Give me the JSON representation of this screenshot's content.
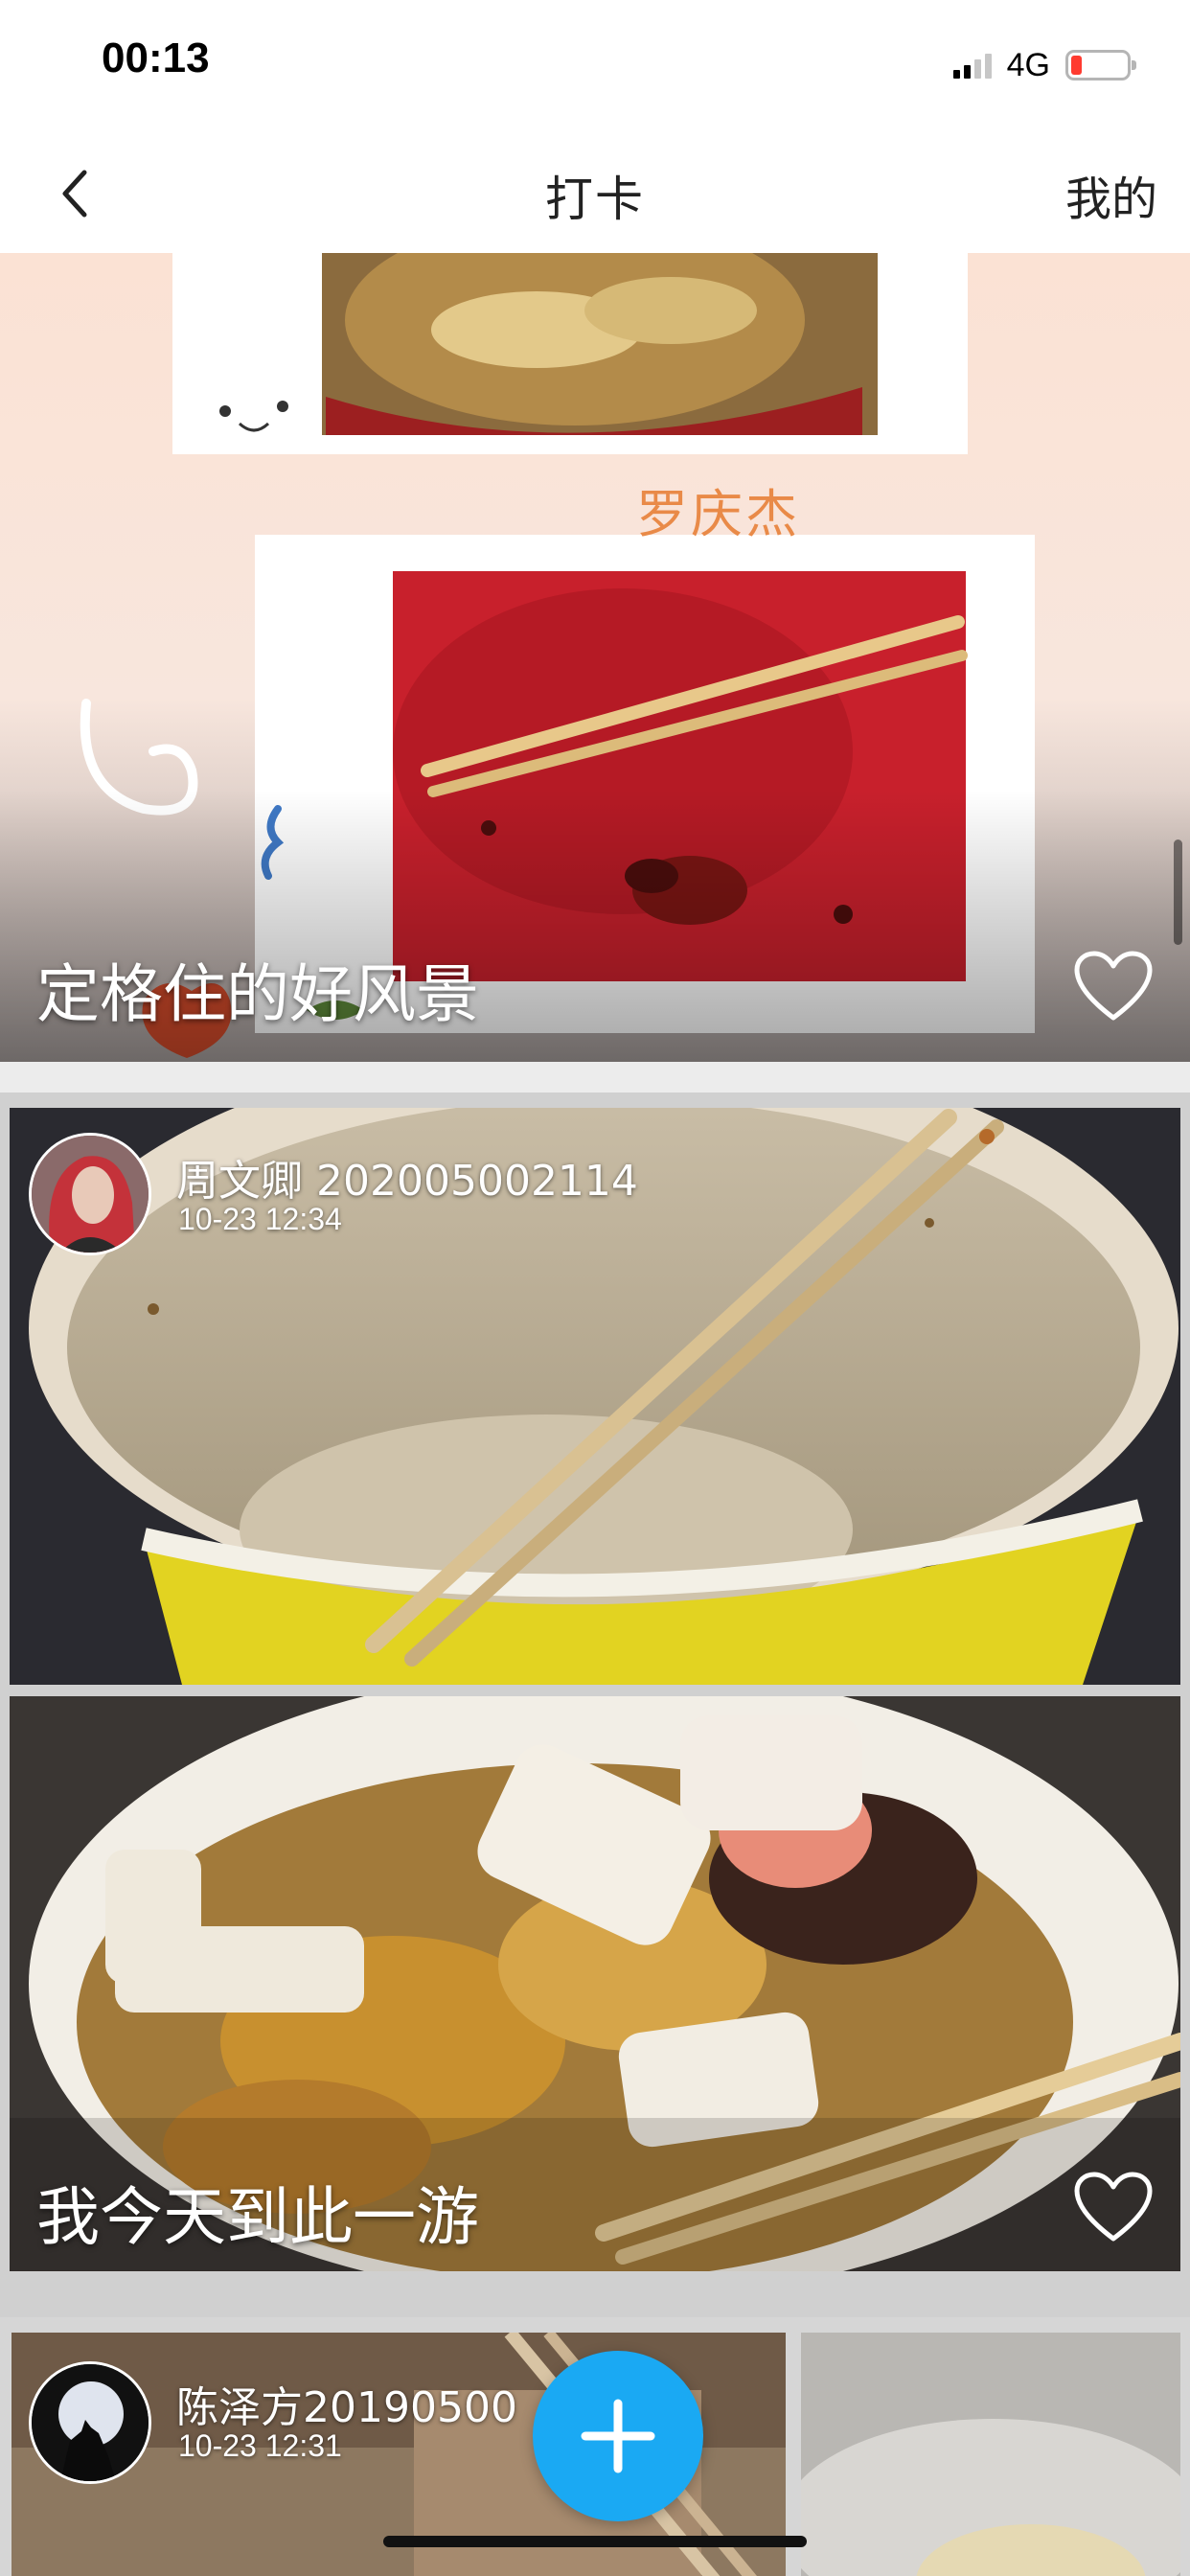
{
  "status_bar": {
    "time": "00:13",
    "network": "4G",
    "battery_color": "#ff3b30"
  },
  "nav": {
    "title": "打卡",
    "right_label": "我的",
    "back_icon": "chevron-left-icon"
  },
  "posts": [
    {
      "caption": "定格住的好风景",
      "photo_text": "罗庆杰",
      "liked": false
    },
    {
      "user_name": "周文卿 202005002114",
      "time": "10-23 12:34",
      "caption": "我今天到此一游",
      "liked": false
    },
    {
      "user_name": "陈泽方20190500",
      "time": "10-23 12:31"
    }
  ],
  "add_button": {
    "icon": "plus-icon",
    "color": "#1aa9f3"
  }
}
